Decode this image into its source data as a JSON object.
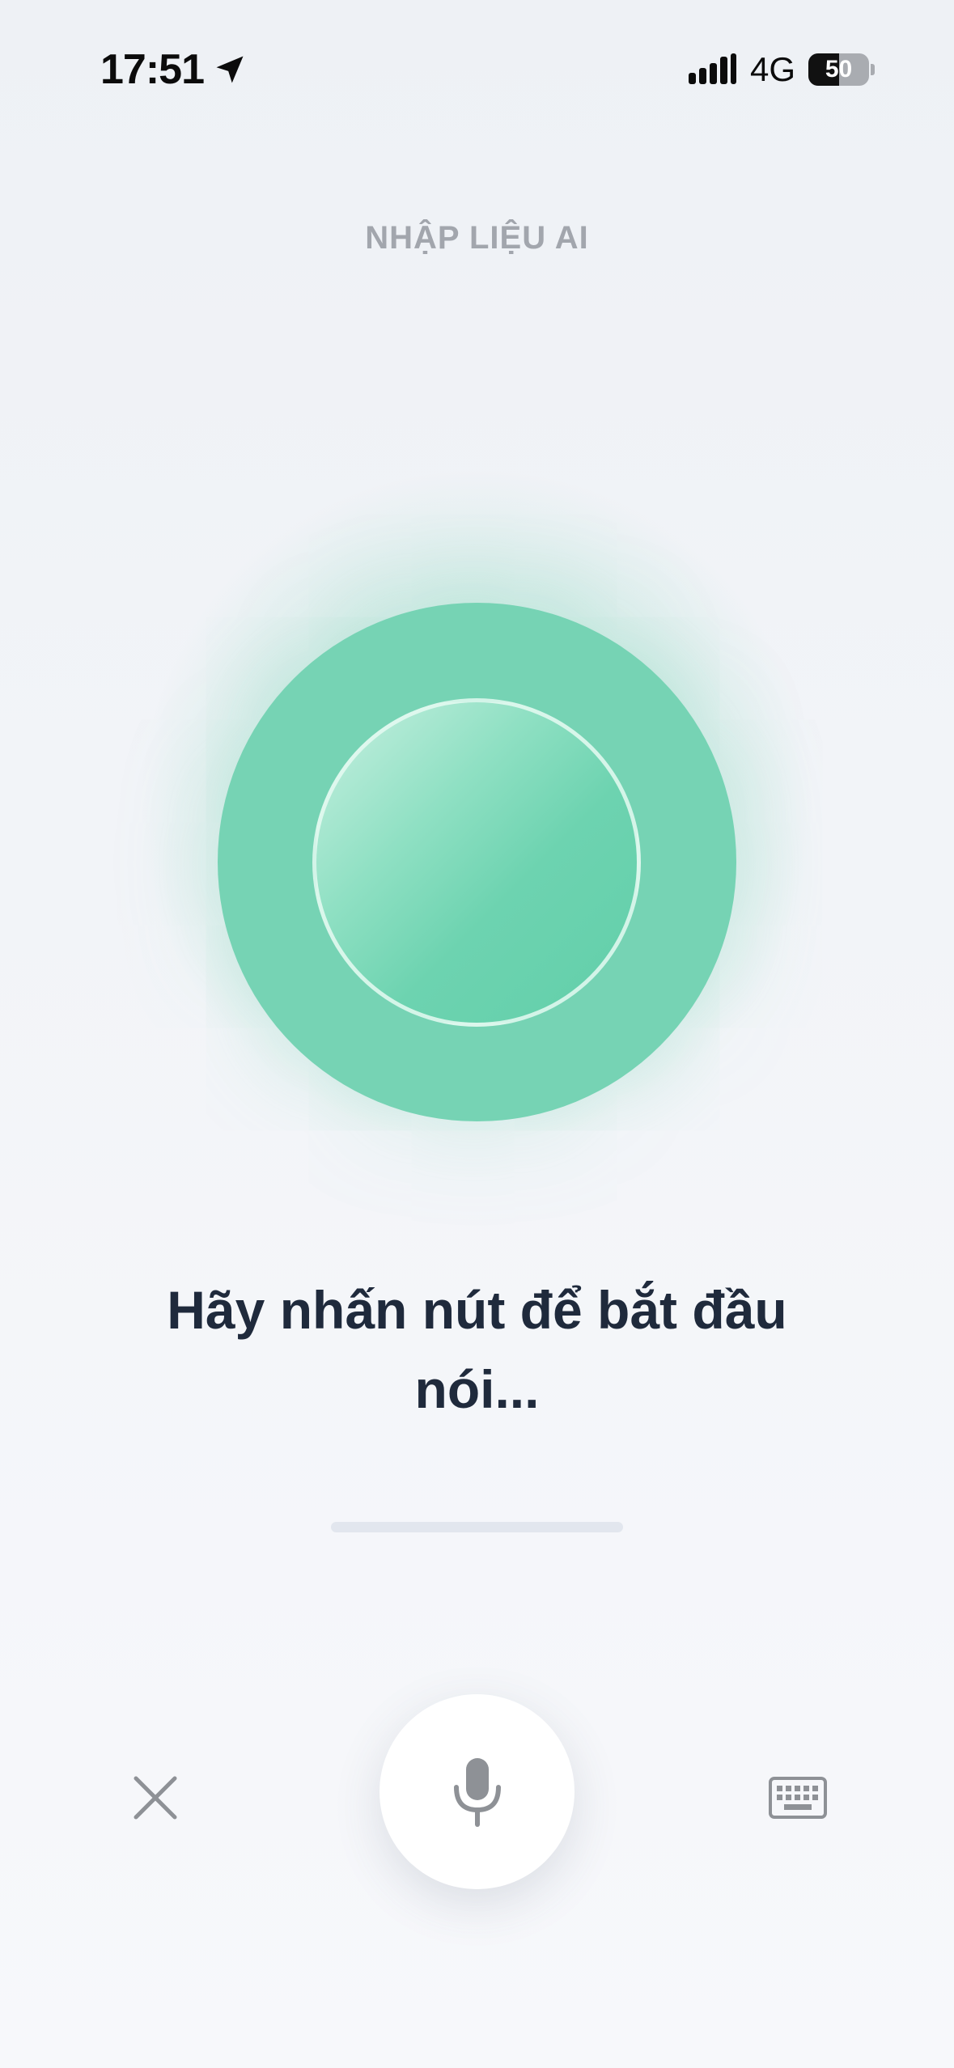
{
  "status_bar": {
    "time": "17:51",
    "network": "4G",
    "battery_text": "50",
    "battery_level": 0.5
  },
  "header": {
    "title": "NHẬP LIỆU AI"
  },
  "voice": {
    "prompt": "Hãy nhấn nút để bắt đầu nói...",
    "state": "idle"
  },
  "controls": {
    "close_icon": "close-icon",
    "mic_icon": "microphone-icon",
    "keyboard_icon": "keyboard-icon"
  },
  "colors": {
    "accent": "#76d3b4",
    "accent_inner": "#62cfaa",
    "icon_gray": "#8e9196",
    "title_gray": "#a2a6ad",
    "text_dark": "#1f2a3c"
  }
}
